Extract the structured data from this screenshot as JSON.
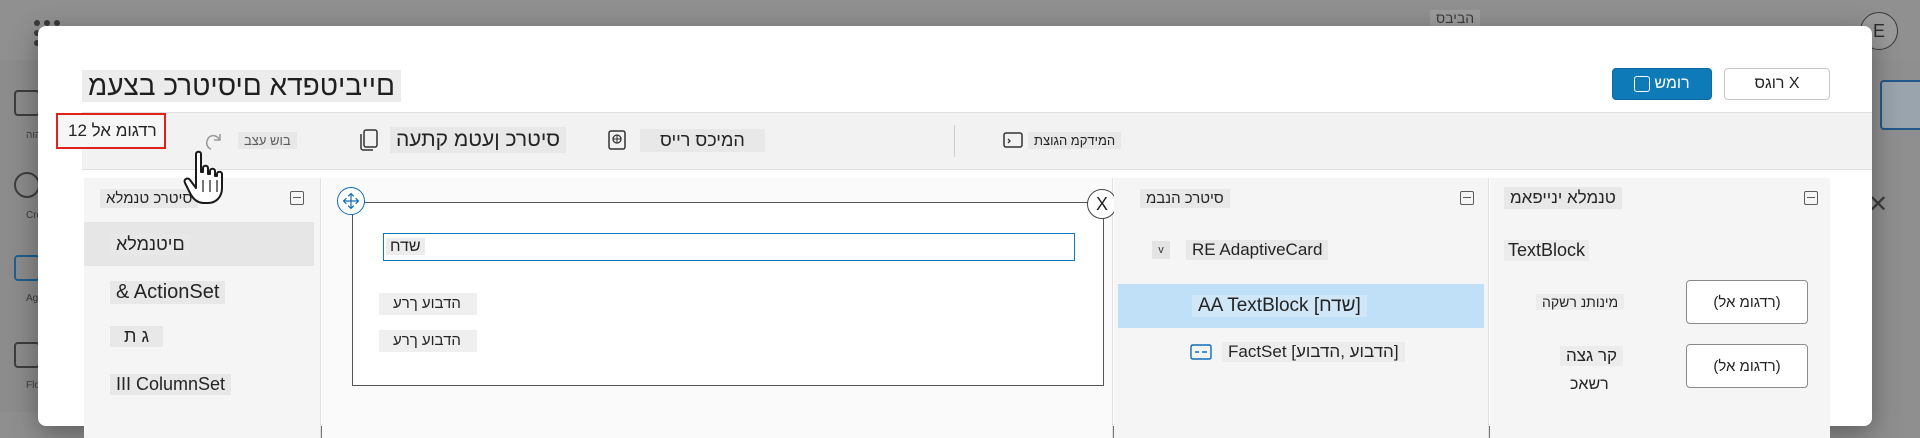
{
  "background_app": {
    "title": "הביבס",
    "avatar_initial": "E",
    "rail": [
      {
        "icon": "home-icon",
        "label": "הוה"
      },
      {
        "icon": "create-icon",
        "label": "Cre"
      },
      {
        "icon": "agents-icon",
        "label": "Ag"
      },
      {
        "icon": "flows-icon",
        "label": "Flo"
      }
    ]
  },
  "dialog": {
    "title": "םייביטפדא םיסיטרכ בצעמ",
    "save_label": "רומש",
    "close_label": "רוגס X"
  },
  "toolbar": {
    "version_label": "רדגומ אל 12",
    "undo_label": "בוש עצב",
    "copy_json_label": "סיטרכ ןעטמ קתעה",
    "schema_label": "המיכס רייס",
    "preview_label": "המידקמ הגוצת"
  },
  "elements_pane": {
    "header": "סיטרכ טנמלא",
    "items": [
      {
        "label": "םיטנמלא"
      },
      {
        "label": "& ActionSet"
      },
      {
        "label": "ג ת"
      },
      {
        "label": "III ColumnSet"
      }
    ]
  },
  "canvas": {
    "textblock_text": "שדח",
    "fact_1": "הדבוע ךרע",
    "fact_2": "הדבוע ךרע",
    "close_glyph": "X"
  },
  "tree_pane": {
    "header": "סיטרכ הנבמ",
    "rows": [
      {
        "chevron": "v",
        "label": "RE AdaptiveCard"
      },
      {
        "label": "AA TextBlock [שדח]"
      },
      {
        "label": "FactSet [הדבוע ,הדבוע]"
      }
    ]
  },
  "props_pane": {
    "header": "טנמלא ינייפאמ",
    "element_type": "TextBlock",
    "rows": [
      {
        "label": "מינותנ רשקה",
        "value": "(רדגומ אל)"
      },
      {
        "label_line1": "קר גצה",
        "label_line2": "רשאכ",
        "value": "(רדגומ אל)"
      }
    ]
  },
  "colors": {
    "accent": "#0f7ab8",
    "selection": "#bfe0f7",
    "highlight_box": "#e0221a"
  }
}
